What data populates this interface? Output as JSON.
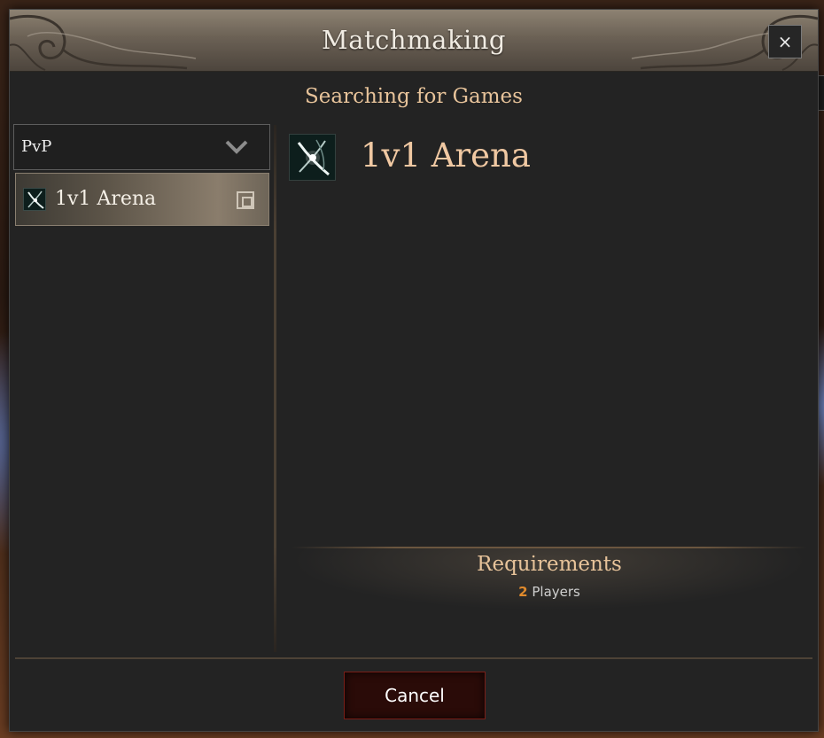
{
  "dialog": {
    "title": "Matchmaking",
    "close_label": "×",
    "status": "Searching for Games"
  },
  "category": {
    "selected": "PvP"
  },
  "modes": [
    {
      "label": "1v1 Arena",
      "icon": "arena-icon",
      "selected": true
    }
  ],
  "detail": {
    "title": "1v1 Arena",
    "icon": "arena-icon",
    "requirements": {
      "heading": "Requirements",
      "count": "2",
      "unit": "Players"
    }
  },
  "actions": {
    "cancel_label": "Cancel"
  },
  "colors": {
    "accent_text": "#e7c39a",
    "title_text": "#f0c8a2",
    "count_text": "#e08a2c",
    "cancel_border": "#7a1e17"
  }
}
